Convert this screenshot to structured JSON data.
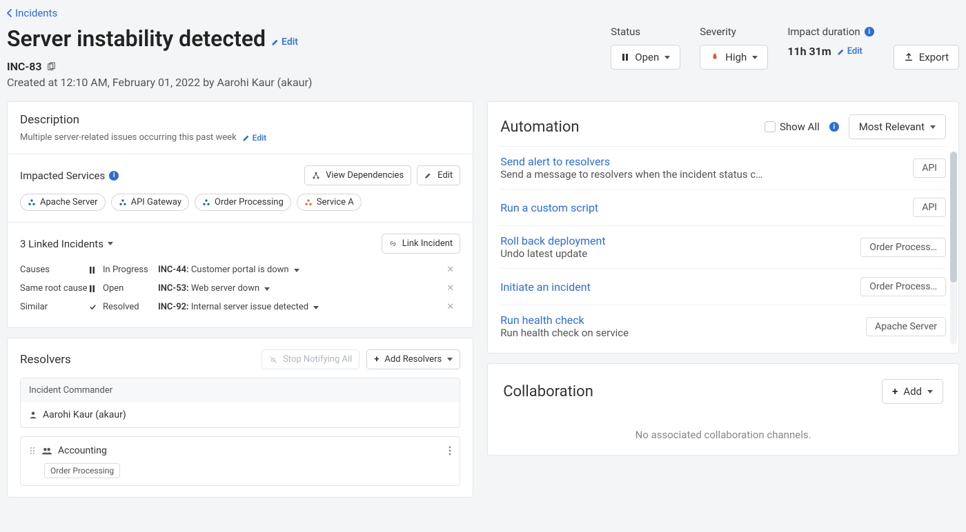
{
  "breadcrumb": {
    "back": "Incidents"
  },
  "incident": {
    "title": "Server instability detected",
    "edit_label": "Edit",
    "id": "INC-83",
    "created_line": "Created at 12:10 AM, February 01, 2022 by Aarohi Kaur (akaur)"
  },
  "meta": {
    "status": {
      "label": "Status",
      "value": "Open"
    },
    "severity": {
      "label": "Severity",
      "value": "High"
    },
    "impact": {
      "label": "Impact duration",
      "value": "11h 31m",
      "edit": "Edit"
    },
    "export": "Export"
  },
  "description": {
    "title": "Description",
    "text": "Multiple server-related issues occurring this past week",
    "edit": "Edit"
  },
  "impacted": {
    "title": "Impacted Services",
    "view_dependencies": "View Dependencies",
    "edit": "Edit",
    "chips": [
      {
        "name": "Apache Server",
        "color": "#1f5db8"
      },
      {
        "name": "API Gateway",
        "color": "#1f5db8"
      },
      {
        "name": "Order Processing",
        "color": "#1f5db8"
      },
      {
        "name": "Service A",
        "color": "#d96a2b"
      }
    ]
  },
  "linked": {
    "title": "3 Linked Incidents",
    "link_button": "Link Incident",
    "rows": [
      {
        "rel": "Causes",
        "status_icon": "pause",
        "status": "In Progress",
        "id": "INC-44:",
        "desc": "Customer portal is down"
      },
      {
        "rel": "Same root cause",
        "status_icon": "pause",
        "status": "Open",
        "id": "INC-53:",
        "desc": "Web server down"
      },
      {
        "rel": "Similar",
        "status_icon": "check",
        "status": "Resolved",
        "id": "INC-92:",
        "desc": "Internal server issue detected"
      }
    ]
  },
  "resolvers": {
    "title": "Resolvers",
    "stop_notify": "Stop Notifying All",
    "add": "Add Resolvers",
    "commander": {
      "header": "Incident Commander",
      "person": "Aarohi Kaur (akaur)"
    },
    "team": {
      "name": "Accounting",
      "service": "Order Processing"
    }
  },
  "automation": {
    "title": "Automation",
    "show_all": "Show All",
    "sort": "Most Relevant",
    "items": [
      {
        "title": "Send alert to resolvers",
        "sub": "Send a message to resolvers when the incident status c…",
        "tag": "API"
      },
      {
        "title": "Run a custom script",
        "sub": "",
        "tag": "API"
      },
      {
        "title": "Roll back deployment",
        "sub": "Undo latest update",
        "tag": "Order Process…"
      },
      {
        "title": "Initiate an incident",
        "sub": "",
        "tag": "Order Process…"
      },
      {
        "title": "Run health check",
        "sub": "Run health check on service",
        "tag": "Apache Server"
      }
    ]
  },
  "collaboration": {
    "title": "Collaboration",
    "add": "Add",
    "empty": "No associated collaboration channels."
  }
}
